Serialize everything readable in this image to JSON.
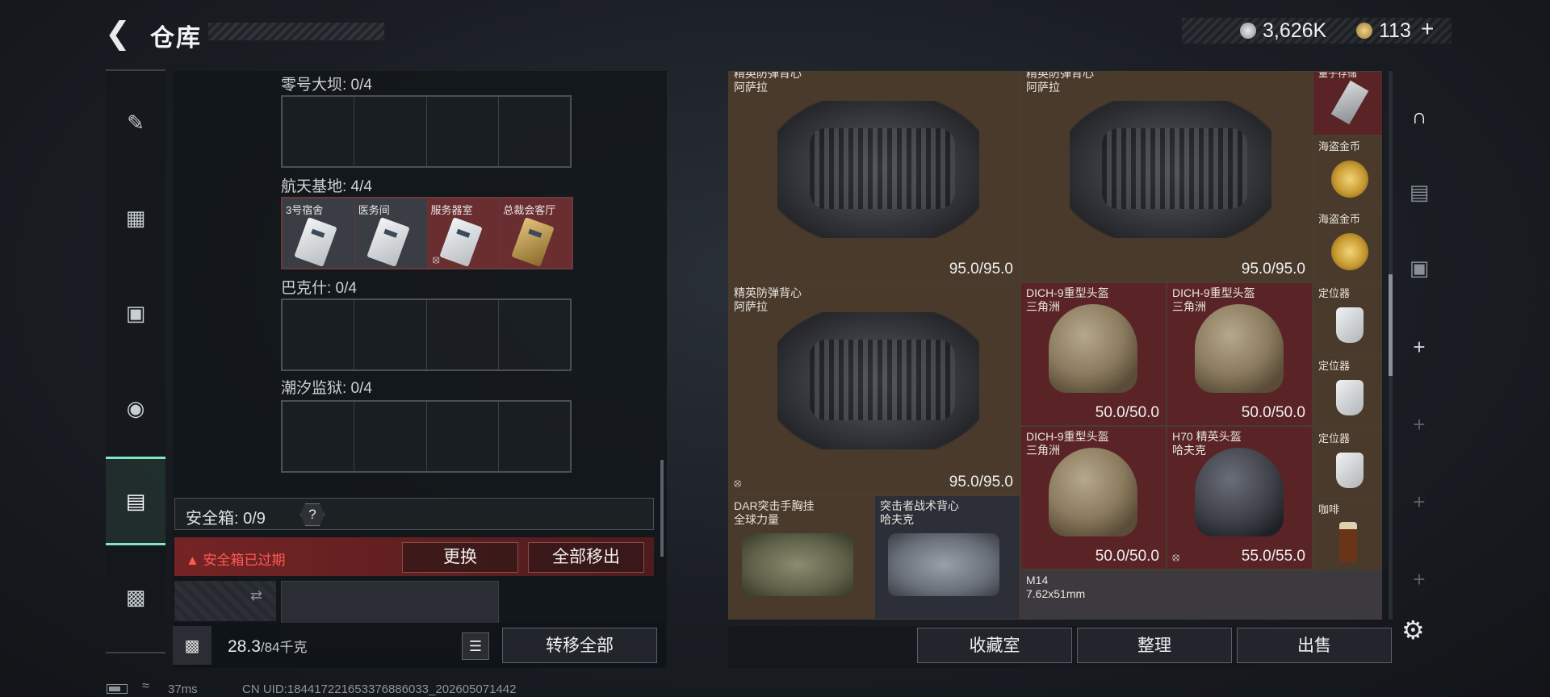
{
  "header": {
    "title": "仓库",
    "currency1_value": "3,626K",
    "currency2_value": "113",
    "add_symbol": "+"
  },
  "nav": {
    "items": [
      {
        "name": "weapon",
        "icon": "gun-icon"
      },
      {
        "name": "armor",
        "icon": "vest-icon"
      },
      {
        "name": "backpack",
        "icon": "backpack-icon"
      },
      {
        "name": "chest-rig",
        "icon": "rig-icon"
      },
      {
        "name": "safebox",
        "icon": "safebox-icon",
        "active": true
      },
      {
        "name": "toolbox",
        "icon": "toolbox-icon"
      }
    ]
  },
  "zones": [
    {
      "label": "零号大坝: 0/4"
    },
    {
      "label": "航天基地: 4/4"
    },
    {
      "label": "巴克什: 0/4"
    },
    {
      "label": "潮汐监狱: 0/4"
    }
  ],
  "keys": [
    {
      "label": "3号宿舍",
      "style": "grey"
    },
    {
      "label": "医务间",
      "style": "grey"
    },
    {
      "label": "服务器室",
      "style": "red",
      "no_drop": true
    },
    {
      "label": "总裁会客厅",
      "style": "red",
      "gold": true
    }
  ],
  "safebox": {
    "label": "安全箱: 0/9",
    "help": "?",
    "expired_text": "安全箱已过期",
    "replace_btn": "更换",
    "move_all_btn": "全部移出"
  },
  "weight": {
    "current": "28.3",
    "max": "/84千克"
  },
  "transfer_all_btn": "转移全部",
  "inventory": {
    "items": [
      {
        "id": "vest1",
        "name": "精英防弹背心",
        "sub": "阿萨拉",
        "durability": "95.0/95.0"
      },
      {
        "id": "vest2",
        "name": "精英防弹背心",
        "sub": "阿萨拉",
        "durability": "95.0/95.0"
      },
      {
        "id": "vest3",
        "name": "精英防弹背心",
        "sub": "阿萨拉",
        "durability": "95.0/95.0"
      },
      {
        "id": "helm1",
        "name": "DICH-9重型头盔",
        "sub": "三角洲",
        "durability": "50.0/50.0"
      },
      {
        "id": "helm2",
        "name": "DICH-9重型头盔",
        "sub": "三角洲",
        "durability": "50.0/50.0"
      },
      {
        "id": "helm3",
        "name": "DICH-9重型头盔",
        "sub": "三角洲",
        "durability": "50.0/50.0"
      },
      {
        "id": "helm4",
        "name": "H70 精英头盔",
        "sub": "哈夫克",
        "durability": "55.0/55.0"
      },
      {
        "id": "rig1",
        "name": "DAR突击手胸挂",
        "sub": "全球力量"
      },
      {
        "id": "rig2",
        "name": "突击者战术背心",
        "sub": "哈夫克"
      },
      {
        "id": "gun1",
        "name": "M14",
        "sub": "7.62x51mm"
      },
      {
        "id": "s1",
        "name": "量子存储"
      },
      {
        "id": "s2",
        "name": "海盗金币"
      },
      {
        "id": "s3",
        "name": "海盗金币"
      },
      {
        "id": "s4",
        "name": "定位器"
      },
      {
        "id": "s5",
        "name": "定位器"
      },
      {
        "id": "s6",
        "name": "定位器"
      },
      {
        "id": "s7",
        "name": "咖啡"
      }
    ]
  },
  "right_bar": [
    {
      "icon": "stash-icon",
      "active": true
    },
    {
      "icon": "folder-icon"
    },
    {
      "icon": "medkit-icon"
    },
    {
      "icon": "plus-icon",
      "label": "+"
    },
    {
      "icon": "plus-icon",
      "label": "+"
    },
    {
      "icon": "plus-icon",
      "label": "+"
    },
    {
      "icon": "plus-icon",
      "label": "+"
    }
  ],
  "bottom_buttons": {
    "collection": "收藏室",
    "organize": "整理",
    "sell": "出售"
  },
  "status": {
    "ping": "37ms",
    "uid": "CN UID:18441722165337688603​3_202605071442"
  }
}
